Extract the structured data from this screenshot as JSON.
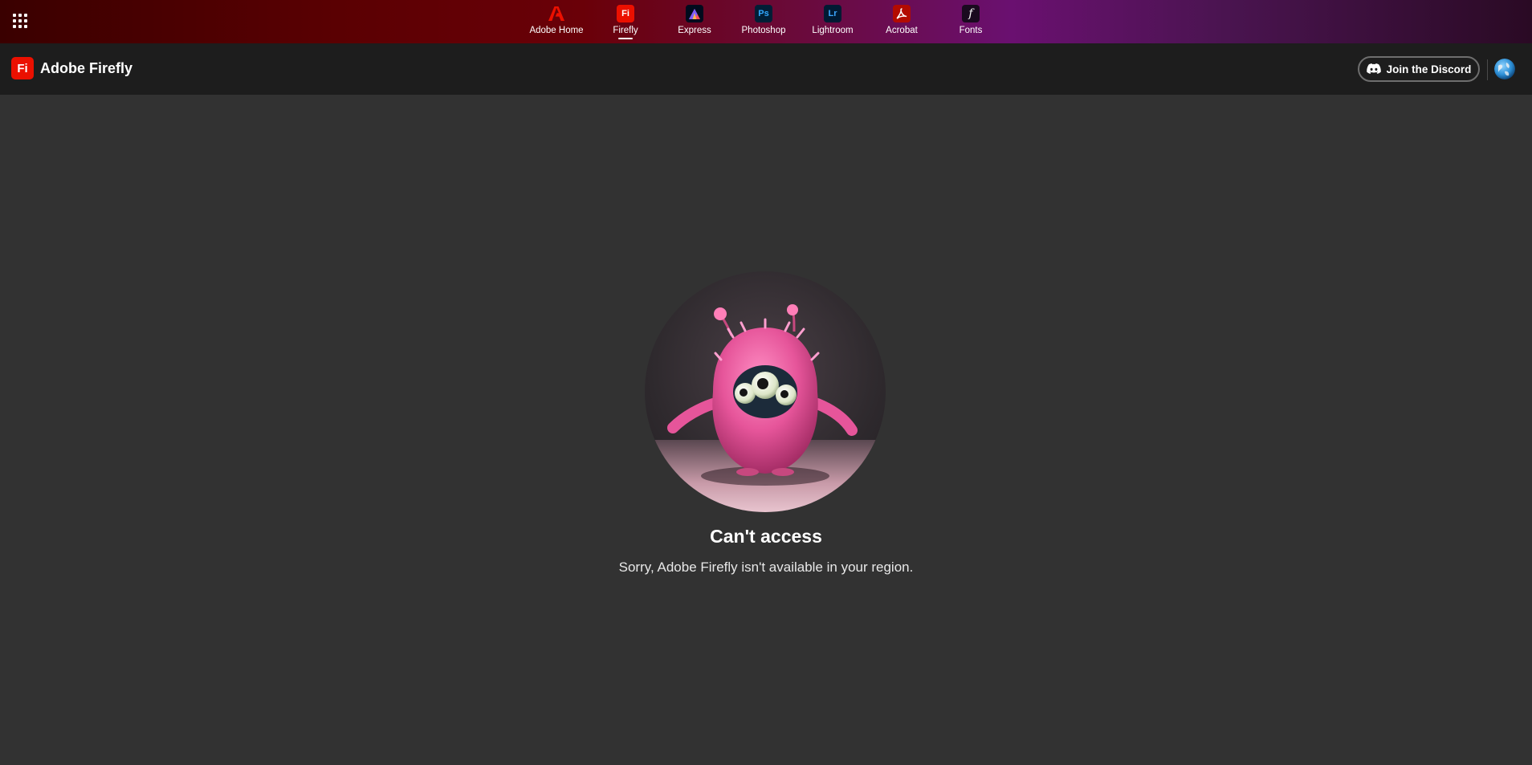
{
  "app_switcher": {
    "items": [
      {
        "label": "Adobe Home",
        "icon": "adobe-icon",
        "selected": false
      },
      {
        "label": "Firefly",
        "icon_text": "Fi",
        "selected": true
      },
      {
        "label": "Express",
        "icon": "express-icon",
        "selected": false
      },
      {
        "label": "Photoshop",
        "icon_text": "Ps",
        "selected": false
      },
      {
        "label": "Lightroom",
        "icon_text": "Lr",
        "selected": false
      },
      {
        "label": "Acrobat",
        "icon": "acrobat-icon",
        "selected": false
      },
      {
        "label": "Fonts",
        "icon_text": "f",
        "selected": false
      }
    ]
  },
  "header": {
    "logo_text": "Fi",
    "title": "Adobe Firefly",
    "discord_button_label": "Join the Discord"
  },
  "main": {
    "heading": "Can't access",
    "message": "Sorry, Adobe Firefly isn't available in your region."
  },
  "colors": {
    "firefly_red": "#eb1000",
    "photoshop_bg": "#001e36",
    "photoshop_fg": "#31a8ff",
    "lightroom_bg": "#001a33",
    "lightroom_fg": "#3ba7ff",
    "page_bg": "#323232",
    "header_bg": "#1d1d1d"
  }
}
